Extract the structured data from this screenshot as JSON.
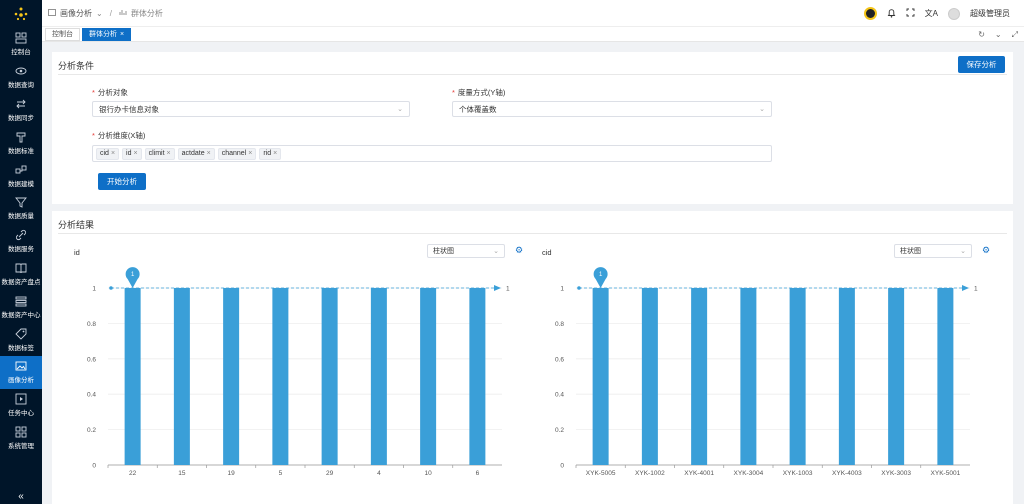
{
  "sidebar": {
    "items": [
      {
        "label": "控制台",
        "icon": "dashboard-icon"
      },
      {
        "label": "数据查询",
        "icon": "eye-icon"
      },
      {
        "label": "数据同步",
        "icon": "sync-icon"
      },
      {
        "label": "数据标准",
        "icon": "standard-icon"
      },
      {
        "label": "数据建模",
        "icon": "model-icon"
      },
      {
        "label": "数据质量",
        "icon": "filter-icon"
      },
      {
        "label": "数据服务",
        "icon": "link-icon"
      },
      {
        "label": "数据资产盘点",
        "icon": "book-icon"
      },
      {
        "label": "数据资产中心",
        "icon": "layers-icon"
      },
      {
        "label": "数据标签",
        "icon": "tag-icon"
      },
      {
        "label": "画像分析",
        "icon": "image-icon",
        "active": true
      },
      {
        "label": "任务中心",
        "icon": "play-icon"
      },
      {
        "label": "系统管理",
        "icon": "grid-icon"
      }
    ],
    "collapse": "«"
  },
  "header": {
    "breadcrumb": [
      "画像分析",
      "群体分析"
    ],
    "user": "超级管理员"
  },
  "tabs": [
    {
      "label": "控制台",
      "active": false
    },
    {
      "label": "群体分析",
      "active": true,
      "close": "×"
    }
  ],
  "conditions": {
    "title": "分析条件",
    "save_label": "保存分析",
    "object_label": "分析对象",
    "object_value": "银行办卡信息对象",
    "measure_label": "度量方式(Y轴)",
    "measure_value": "个体覆盖数",
    "dimension_label": "分析维度(X轴)",
    "dimension_tags": [
      "cid",
      "id",
      "climit",
      "actdate",
      "channel",
      "rid"
    ],
    "start_label": "开始分析"
  },
  "results": {
    "title": "分析结果",
    "chart_type_label": "柱状图"
  },
  "chart_data": [
    {
      "type": "bar",
      "title": "id",
      "categories": [
        "22",
        "15",
        "19",
        "5",
        "29",
        "4",
        "10",
        "6"
      ],
      "values": [
        1,
        1,
        1,
        1,
        1,
        1,
        1,
        1
      ],
      "yticks": [
        "0",
        "0.2",
        "0.4",
        "0.6",
        "0.8",
        "1"
      ],
      "ylim": [
        0,
        1
      ],
      "markpoint": "1",
      "markline": "1",
      "color": "#3a9fd8"
    },
    {
      "type": "bar",
      "title": "cid",
      "categories": [
        "XYK-5005",
        "XYK-1002",
        "XYK-4001",
        "XYK-3004",
        "XYK-1003",
        "XYK-4003",
        "XYK-3003",
        "XYK-5001"
      ],
      "values": [
        1,
        1,
        1,
        1,
        1,
        1,
        1,
        1
      ],
      "yticks": [
        "0",
        "0.2",
        "0.4",
        "0.6",
        "0.8",
        "1"
      ],
      "ylim": [
        0,
        1
      ],
      "markpoint": "1",
      "markline": "1",
      "color": "#3a9fd8"
    }
  ]
}
